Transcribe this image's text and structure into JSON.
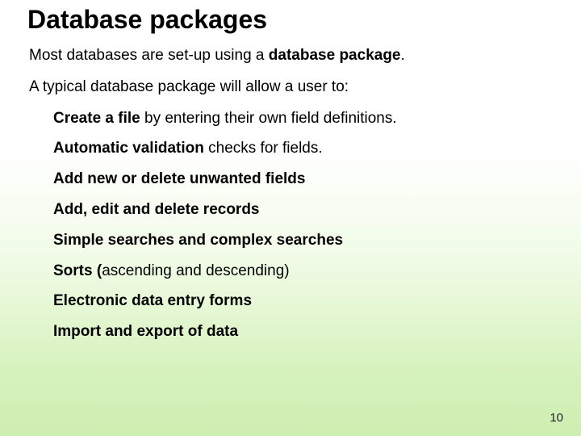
{
  "title": "Database packages",
  "intro1_a": "Most databases are set-up using a ",
  "intro1_b": "database package",
  "intro1_c": ".",
  "intro2": "A typical database package will allow a user to:",
  "items": {
    "i1_a": "Create a file",
    "i1_b": " by entering their own field definitions.",
    "i2_a": "Automatic validation",
    "i2_b": " checks for fields.",
    "i3": "Add new or delete unwanted fields",
    "i4": "Add, edit and delete records",
    "i5": "Simple searches and complex searches",
    "i6_a": "Sorts (",
    "i6_b": "ascending and descending)",
    "i7": "Electronic data entry forms",
    "i8": "Import and export of data"
  },
  "page_number": "10"
}
